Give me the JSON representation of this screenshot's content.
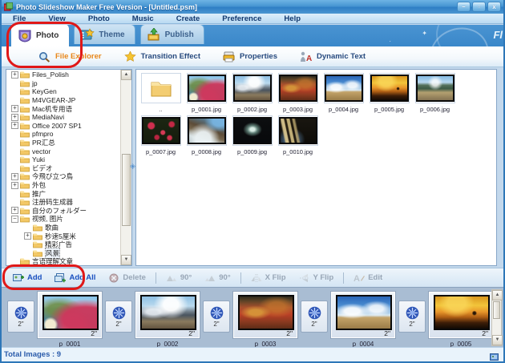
{
  "colors": {
    "annotation_red": "#e01818",
    "titlebar_blue": "#3a87c9",
    "active_tool_orange": "#e8871a",
    "enabled_action_blue": "#1a50c0"
  },
  "window": {
    "title": "Photo Slideshow Maker Free Version - [Untitled.psm]",
    "controls": [
      {
        "id": "minimize",
        "glyph": "–"
      },
      {
        "id": "restore",
        "glyph": "▫"
      },
      {
        "id": "close",
        "glyph": "x"
      }
    ]
  },
  "menu": {
    "items": [
      "File",
      "View",
      "Photo",
      "Music",
      "Create",
      "Preference",
      "Help"
    ]
  },
  "tabstrip": {
    "logo_fragment": "Fl",
    "tabs": [
      {
        "id": "photo",
        "label": "Photo",
        "icon": "photo-tab-icon",
        "active": true
      },
      {
        "id": "theme",
        "label": "Theme",
        "icon": "theme-tab-icon",
        "active": false
      },
      {
        "id": "publish",
        "label": "Publish",
        "icon": "publish-tab-icon",
        "active": false
      }
    ]
  },
  "toolbar": {
    "items": [
      {
        "id": "file-explorer",
        "label": "File Explorer",
        "icon": "magnifier-icon",
        "active": true
      },
      {
        "id": "transition-effect",
        "label": "Transition Effect",
        "icon": "star-icon",
        "active": false
      },
      {
        "id": "properties",
        "label": "Properties",
        "icon": "printer-icon",
        "active": false
      },
      {
        "id": "dynamic-text",
        "label": "Dynamic Text",
        "icon": "text-icon",
        "active": false
      }
    ]
  },
  "tree": {
    "items": [
      {
        "label": "Files_Polish",
        "expander": "+",
        "level": 1
      },
      {
        "label": "jp",
        "level": 1
      },
      {
        "label": "KeyGen",
        "level": 1
      },
      {
        "label": "M4VGEAR-JP",
        "level": 1
      },
      {
        "label": "Mac机专用语",
        "expander": "+",
        "level": 1
      },
      {
        "label": "MediaNavi",
        "expander": "+",
        "level": 1
      },
      {
        "label": "Office 2007 SP1",
        "expander": "+",
        "level": 1
      },
      {
        "label": "pfmpro",
        "level": 1
      },
      {
        "label": "PR汇总",
        "level": 1
      },
      {
        "label": "vector",
        "level": 1
      },
      {
        "label": "Yuki",
        "level": 1
      },
      {
        "label": "ビデオ",
        "level": 1
      },
      {
        "label": "今飛び立つ鳥",
        "expander": "+",
        "level": 1
      },
      {
        "label": "外包",
        "expander": "+",
        "level": 1
      },
      {
        "label": "推广",
        "level": 1
      },
      {
        "label": "注册码生成器",
        "level": 1
      },
      {
        "label": "自分のフォルダー",
        "expander": "+",
        "level": 1
      },
      {
        "label": "视频, 图片",
        "expander": "-",
        "level": 1
      },
      {
        "label": "歌曲",
        "level": 2
      },
      {
        "label": "秒速5厘米",
        "expander": "+",
        "level": 2
      },
      {
        "label": "精彩广告",
        "level": 2
      },
      {
        "label": "风景",
        "level": 2,
        "selected": true
      },
      {
        "label": "言语理解文章",
        "level": 1
      }
    ]
  },
  "grid": {
    "cells": [
      {
        "type": "folder-up",
        "label": ".."
      },
      {
        "type": "photo",
        "photo": "p1",
        "label": "p_0001.jpg"
      },
      {
        "type": "photo",
        "photo": "p2",
        "label": "p_0002.jpg"
      },
      {
        "type": "photo",
        "photo": "p3",
        "label": "p_0003.jpg"
      },
      {
        "type": "photo",
        "photo": "p4",
        "label": "p_0004.jpg"
      },
      {
        "type": "photo",
        "photo": "p5",
        "label": "p_0005.jpg"
      },
      {
        "type": "photo",
        "photo": "p6",
        "label": "p_0006.jpg"
      },
      {
        "type": "photo",
        "photo": "p7",
        "label": "p_0007.jpg"
      },
      {
        "type": "photo",
        "photo": "p8",
        "label": "p_0008.jpg"
      },
      {
        "type": "photo",
        "photo": "p9",
        "label": "p_0009.jpg"
      },
      {
        "type": "photo",
        "photo": "p10",
        "label": "p_0010.jpg"
      }
    ]
  },
  "actionbar": {
    "items": [
      {
        "id": "add",
        "label": "Add",
        "icon": "add-image-icon",
        "enabled": true
      },
      {
        "id": "add-all",
        "label": "Add All",
        "icon": "add-all-icon",
        "enabled": true
      },
      {
        "id": "delete",
        "label": "Delete",
        "icon": "delete-icon",
        "enabled": false
      },
      {
        "id": "rotate-left",
        "label": "90°",
        "icon": "rotate-left-icon",
        "enabled": false
      },
      {
        "id": "rotate-right",
        "label": "90°",
        "icon": "rotate-right-icon",
        "enabled": false
      },
      {
        "id": "x-flip",
        "label": "X Flip",
        "icon": "x-flip-icon",
        "enabled": false
      },
      {
        "id": "y-flip",
        "label": "Y Flip",
        "icon": "y-flip-icon",
        "enabled": false
      },
      {
        "id": "edit",
        "label": "Edit",
        "icon": "edit-icon",
        "enabled": false
      }
    ],
    "separators_after": [
      2,
      4,
      6
    ]
  },
  "timeline": {
    "cells": [
      {
        "type": "transition",
        "duration": "2\""
      },
      {
        "type": "photo",
        "photo": "p1",
        "label": "p_0001",
        "duration": "2\""
      },
      {
        "type": "transition",
        "duration": "2\""
      },
      {
        "type": "photo",
        "photo": "p2",
        "label": "p_0002",
        "duration": "2\""
      },
      {
        "type": "transition",
        "duration": "2\""
      },
      {
        "type": "photo",
        "photo": "p3",
        "label": "p_0003",
        "duration": "2\""
      },
      {
        "type": "transition",
        "duration": "2\""
      },
      {
        "type": "photo",
        "photo": "p4",
        "label": "p_0004",
        "duration": "2\""
      },
      {
        "type": "transition",
        "duration": "2\""
      },
      {
        "type": "photo",
        "photo": "p5",
        "label": "p_0005",
        "duration": "2\""
      }
    ]
  },
  "statusbar": {
    "text": "Total Images : 9"
  }
}
